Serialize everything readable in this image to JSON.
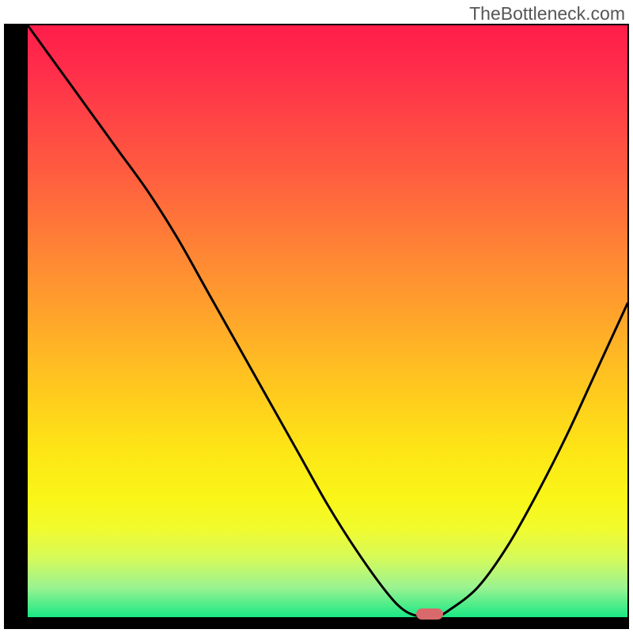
{
  "watermark": "TheBottleneck.com",
  "chart_data": {
    "type": "line",
    "title": "",
    "xlabel": "",
    "ylabel": "",
    "xlim": [
      0,
      100
    ],
    "ylim": [
      0,
      100
    ],
    "series": [
      {
        "name": "curve",
        "x": [
          0,
          5,
          10,
          15,
          20,
          25,
          30,
          35,
          40,
          45,
          50,
          55,
          60,
          63,
          66,
          68,
          70,
          75,
          80,
          85,
          90,
          95,
          100
        ],
        "y": [
          100,
          93,
          86,
          79,
          72,
          64,
          55,
          46,
          37,
          28,
          19,
          11,
          4,
          1,
          0,
          0,
          1,
          5,
          12,
          21,
          31,
          42,
          53
        ]
      }
    ],
    "marker": {
      "x": 67,
      "y": 0.5
    },
    "gradient_stops": [
      {
        "pos": 0,
        "color": "#ff1d4a"
      },
      {
        "pos": 8,
        "color": "#ff2e4a"
      },
      {
        "pos": 16,
        "color": "#ff4545"
      },
      {
        "pos": 24,
        "color": "#ff5a40"
      },
      {
        "pos": 32,
        "color": "#ff723a"
      },
      {
        "pos": 40,
        "color": "#ff8a33"
      },
      {
        "pos": 48,
        "color": "#ffa12c"
      },
      {
        "pos": 56,
        "color": "#ffb924"
      },
      {
        "pos": 64,
        "color": "#ffd01c"
      },
      {
        "pos": 72,
        "color": "#fde616"
      },
      {
        "pos": 80,
        "color": "#f9f618"
      },
      {
        "pos": 85,
        "color": "#f1fb2e"
      },
      {
        "pos": 90,
        "color": "#d6fa5a"
      },
      {
        "pos": 95,
        "color": "#9af391"
      },
      {
        "pos": 100,
        "color": "#19e884"
      }
    ]
  }
}
